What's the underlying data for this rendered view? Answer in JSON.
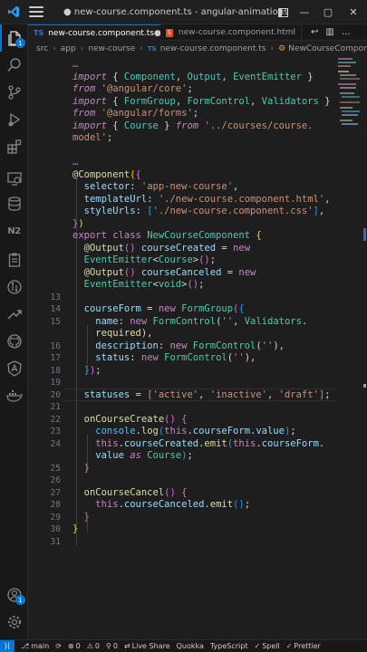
{
  "window": {
    "title": "● new-course.component.ts - angular-animations - Visual ...",
    "colors": {
      "accent": "#0078d4",
      "background": "#1e1e1e"
    }
  },
  "activity_bar": {
    "items": [
      {
        "name": "explorer-icon",
        "badge": "1"
      },
      {
        "name": "search-icon"
      },
      {
        "name": "source-control-icon"
      },
      {
        "name": "run-debug-icon"
      },
      {
        "name": "extensions-icon"
      },
      {
        "name": "remote-explorer-icon"
      },
      {
        "name": "database-icon"
      },
      {
        "name": "nx-console-icon",
        "text": "N2"
      },
      {
        "name": "clipboard-icon"
      },
      {
        "name": "pull-request-icon"
      },
      {
        "name": "liveshare-icon"
      },
      {
        "name": "github-icon"
      },
      {
        "name": "angular-icon"
      },
      {
        "name": "docker-icon"
      }
    ],
    "bottom": [
      {
        "name": "accounts-icon",
        "badge": "1"
      },
      {
        "name": "manage-gear-icon"
      }
    ]
  },
  "tabs": [
    {
      "lang": "TS",
      "label": "new-course.component.ts",
      "modified": "●",
      "active": true
    },
    {
      "lang": "HTML",
      "label": "new-course.component.html",
      "active": false
    }
  ],
  "breadcrumb": {
    "items": [
      "src",
      "app",
      "new-course"
    ],
    "file_lang": "TS",
    "file": "new-course.component.ts",
    "symbol": "NewCourseComponent"
  },
  "editor": {
    "lines": [
      {
        "n": "",
        "tokens": [
          [
            "fold",
            "…"
          ]
        ]
      },
      {
        "n": "",
        "tokens": [
          [
            "kwi",
            "import"
          ],
          [
            "op",
            " { "
          ],
          [
            "cls",
            "Component"
          ],
          [
            "op",
            ", "
          ],
          [
            "cls",
            "Output"
          ],
          [
            "op",
            ", "
          ],
          [
            "cls",
            "EventEmitter"
          ],
          [
            "op",
            " }"
          ]
        ]
      },
      {
        "n": "",
        "tokens": [
          [
            "kwi",
            "from"
          ],
          [
            "op",
            " "
          ],
          [
            "str",
            "'@angular/core'"
          ],
          [
            "op",
            ";"
          ]
        ]
      },
      {
        "n": "",
        "tokens": [
          [
            "kwi",
            "import"
          ],
          [
            "op",
            " { "
          ],
          [
            "cls",
            "FormGroup"
          ],
          [
            "op",
            ", "
          ],
          [
            "cls",
            "FormControl"
          ],
          [
            "op",
            ", "
          ],
          [
            "cls",
            "Validators"
          ],
          [
            "op",
            " }"
          ]
        ]
      },
      {
        "n": "",
        "tokens": [
          [
            "kwi",
            "from"
          ],
          [
            "op",
            " "
          ],
          [
            "str",
            "'@angular/forms'"
          ],
          [
            "op",
            ";"
          ]
        ]
      },
      {
        "n": "",
        "tokens": [
          [
            "kwi",
            "import"
          ],
          [
            "op",
            " { "
          ],
          [
            "cls",
            "Course"
          ],
          [
            "op",
            " } "
          ],
          [
            "kwi",
            "from"
          ],
          [
            "op",
            " "
          ],
          [
            "str",
            "'../courses/course."
          ]
        ]
      },
      {
        "n": "",
        "tokens": [
          [
            "str",
            "model'"
          ],
          [
            "op",
            ";"
          ]
        ]
      },
      {
        "n": "",
        "tokens": []
      },
      {
        "n": "",
        "tokens": [
          [
            "fold",
            "…"
          ]
        ]
      },
      {
        "n": "",
        "tokens": [
          [
            "dec",
            "@Component"
          ],
          [
            "pb",
            "("
          ],
          [
            "pp",
            "{"
          ]
        ]
      },
      {
        "n": "",
        "tokens": [
          [
            "prop",
            "  selector"
          ],
          [
            "op",
            ": "
          ],
          [
            "str",
            "'app-new-course'"
          ],
          [
            "op",
            ","
          ]
        ]
      },
      {
        "n": "",
        "tokens": [
          [
            "prop",
            "  templateUrl"
          ],
          [
            "op",
            ": "
          ],
          [
            "str",
            "'./new-course.component.html'"
          ],
          [
            "op",
            ","
          ]
        ]
      },
      {
        "n": "",
        "tokens": [
          [
            "prop",
            "  styleUrls"
          ],
          [
            "op",
            ": "
          ],
          [
            "pbl",
            "["
          ],
          [
            "str",
            "'./new-course.component.css'"
          ],
          [
            "pbl",
            "]"
          ],
          [
            "op",
            ","
          ]
        ]
      },
      {
        "n": "",
        "tokens": [
          [
            "pp",
            "}"
          ],
          [
            "pb",
            ")"
          ]
        ]
      },
      {
        "n": "",
        "tokens": [
          [
            "kw",
            "export"
          ],
          [
            "op",
            " "
          ],
          [
            "kw",
            "class"
          ],
          [
            "op",
            " "
          ],
          [
            "cls",
            "NewCourseComponent"
          ],
          [
            "op",
            " "
          ],
          [
            "pb",
            "{"
          ]
        ]
      },
      {
        "n": "",
        "tokens": [
          [
            "dec",
            "  @Output"
          ],
          [
            "pp",
            "()"
          ],
          [
            "op",
            " "
          ],
          [
            "prop",
            "courseCreated"
          ],
          [
            "op",
            " = "
          ],
          [
            "kw",
            "new"
          ]
        ]
      },
      {
        "n": "",
        "tokens": [
          [
            "cls",
            "  EventEmitter"
          ],
          [
            "op",
            "<"
          ],
          [
            "cls",
            "Course"
          ],
          [
            "op",
            ">"
          ],
          [
            "pp",
            "()"
          ],
          [
            "op",
            ";"
          ]
        ]
      },
      {
        "n": "",
        "tokens": [
          [
            "dec",
            "  @Output"
          ],
          [
            "pp",
            "()"
          ],
          [
            "op",
            " "
          ],
          [
            "prop",
            "courseCanceled"
          ],
          [
            "op",
            " = "
          ],
          [
            "kw",
            "new"
          ]
        ]
      },
      {
        "n": "",
        "tokens": [
          [
            "cls",
            "  EventEmitter"
          ],
          [
            "op",
            "<"
          ],
          [
            "cls",
            "void"
          ],
          [
            "op",
            ">"
          ],
          [
            "pp",
            "()"
          ],
          [
            "op",
            ";"
          ]
        ]
      },
      {
        "n": "13",
        "tokens": []
      },
      {
        "n": "14",
        "tokens": [
          [
            "prop",
            "  courseForm"
          ],
          [
            "op",
            " = "
          ],
          [
            "kw",
            "new"
          ],
          [
            "op",
            " "
          ],
          [
            "cls",
            "FormGroup"
          ],
          [
            "pp",
            "("
          ],
          [
            "pbl",
            "{"
          ]
        ]
      },
      {
        "n": "15",
        "tokens": [
          [
            "prop",
            "    name"
          ],
          [
            "op",
            ": "
          ],
          [
            "kw",
            "new"
          ],
          [
            "op",
            " "
          ],
          [
            "cls",
            "FormControl"
          ],
          [
            "op",
            "("
          ],
          [
            "str",
            "''"
          ],
          [
            "op",
            ", "
          ],
          [
            "cls",
            "Validators"
          ],
          [
            "op",
            "."
          ]
        ]
      },
      {
        "n": "",
        "tokens": [
          [
            "fn",
            "    required"
          ],
          [
            "op",
            "),"
          ]
        ]
      },
      {
        "n": "16",
        "tokens": [
          [
            "prop",
            "    description"
          ],
          [
            "op",
            ": "
          ],
          [
            "kw",
            "new"
          ],
          [
            "op",
            " "
          ],
          [
            "cls",
            "FormControl"
          ],
          [
            "op",
            "("
          ],
          [
            "str",
            "''"
          ],
          [
            "op",
            "),"
          ]
        ]
      },
      {
        "n": "17",
        "tokens": [
          [
            "prop",
            "    status"
          ],
          [
            "op",
            ": "
          ],
          [
            "kw",
            "new"
          ],
          [
            "op",
            " "
          ],
          [
            "cls",
            "FormControl"
          ],
          [
            "op",
            "("
          ],
          [
            "str",
            "''"
          ],
          [
            "op",
            "),"
          ]
        ]
      },
      {
        "n": "18",
        "tokens": [
          [
            "pbl",
            "  }"
          ],
          [
            "pp",
            ")"
          ],
          [
            "op",
            ";"
          ]
        ]
      },
      {
        "n": "19",
        "tokens": []
      },
      {
        "n": "20",
        "tokens": [
          [
            "prop",
            "  statuses"
          ],
          [
            "op",
            " = "
          ],
          [
            "pp",
            "["
          ],
          [
            "str",
            "'active'"
          ],
          [
            "op",
            ", "
          ],
          [
            "str",
            "'inactive'"
          ],
          [
            "op",
            ", "
          ],
          [
            "str",
            "'draft'"
          ],
          [
            "pp",
            "]"
          ],
          [
            "op",
            ";"
          ]
        ]
      },
      {
        "n": "21",
        "tokens": []
      },
      {
        "n": "22",
        "tokens": [
          [
            "fn",
            "  onCourseCreate"
          ],
          [
            "pp",
            "()"
          ],
          [
            "op",
            " "
          ],
          [
            "pp",
            "{"
          ]
        ]
      },
      {
        "n": "23",
        "tokens": [
          [
            "vr",
            "    console"
          ],
          [
            "op",
            "."
          ],
          [
            "fn",
            "log"
          ],
          [
            "pbl",
            "("
          ],
          [
            "kw",
            "this"
          ],
          [
            "op",
            "."
          ],
          [
            "prop",
            "courseForm"
          ],
          [
            "op",
            "."
          ],
          [
            "prop",
            "value"
          ],
          [
            "pbl",
            ")"
          ],
          [
            "op",
            ";"
          ]
        ]
      },
      {
        "n": "24",
        "tokens": [
          [
            "kw",
            "    this"
          ],
          [
            "op",
            "."
          ],
          [
            "prop",
            "courseCreated"
          ],
          [
            "op",
            "."
          ],
          [
            "fn",
            "emit"
          ],
          [
            "pbl",
            "("
          ],
          [
            "kw",
            "this"
          ],
          [
            "op",
            "."
          ],
          [
            "prop",
            "courseForm"
          ],
          [
            "op",
            "."
          ]
        ]
      },
      {
        "n": "",
        "tokens": [
          [
            "prop",
            "    value"
          ],
          [
            "op",
            " "
          ],
          [
            "kwi",
            "as"
          ],
          [
            "op",
            " "
          ],
          [
            "cls",
            "Course"
          ],
          [
            "pbl",
            ")"
          ],
          [
            "op",
            ";"
          ]
        ]
      },
      {
        "n": "25",
        "tokens": [
          [
            "pp",
            "  }"
          ]
        ]
      },
      {
        "n": "26",
        "tokens": []
      },
      {
        "n": "27",
        "tokens": [
          [
            "fn",
            "  onCourseCancel"
          ],
          [
            "pp",
            "()"
          ],
          [
            "op",
            " "
          ],
          [
            "pp",
            "{"
          ]
        ]
      },
      {
        "n": "28",
        "tokens": [
          [
            "kw",
            "    this"
          ],
          [
            "op",
            "."
          ],
          [
            "prop",
            "courseCanceled"
          ],
          [
            "op",
            "."
          ],
          [
            "fn",
            "emit"
          ],
          [
            "pbl",
            "()"
          ],
          [
            "op",
            ";"
          ]
        ]
      },
      {
        "n": "29",
        "tokens": [
          [
            "pp",
            "  }"
          ]
        ]
      },
      {
        "n": "30",
        "tokens": [
          [
            "pb",
            "}"
          ]
        ]
      },
      {
        "n": "31",
        "tokens": []
      }
    ]
  },
  "statusbar": {
    "items": [
      {
        "name": "branch-status",
        "icon": "⎇",
        "text": "main"
      },
      {
        "name": "sync-status",
        "icon": "⟳",
        "text": ""
      },
      {
        "name": "errors-status",
        "icon": "⊗",
        "text": "0"
      },
      {
        "name": "warnings-status",
        "icon": "⚠",
        "text": "0"
      },
      {
        "name": "ports-status",
        "icon": "⚲",
        "text": "0"
      },
      {
        "name": "liveshare-status",
        "icon": "⇄",
        "text": "Live Share"
      },
      {
        "name": "quokka-status",
        "icon": "",
        "text": "Quokka"
      },
      {
        "name": "typescript-status",
        "icon": "",
        "text": "TypeScript"
      },
      {
        "name": "spell-status",
        "icon": "✓",
        "text": "Spell"
      },
      {
        "name": "prettier-status",
        "icon": "✓",
        "text": "Prettier"
      }
    ]
  }
}
